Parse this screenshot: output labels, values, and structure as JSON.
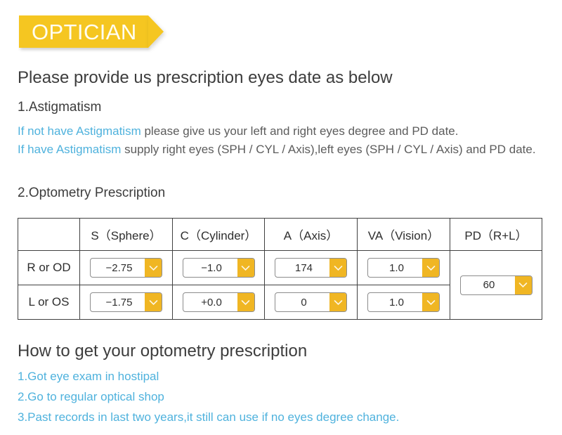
{
  "banner": {
    "label": "OPTICIAN",
    "color": "#f5c621",
    "text_color": "#fffdf2"
  },
  "headings": {
    "main": "Please provide us prescription eyes date as below",
    "section1": "1.Astigmatism",
    "section2": "2.Optometry Prescription",
    "how_to": "How to get your optometry prescription"
  },
  "astigmatism": {
    "line1_highlight": "If not have Astigmatism",
    "line1_rest": "  please give us your left and right eyes degree and PD date.",
    "line2_highlight": "If have Astigmatism",
    "line2_rest": "  supply right eyes (SPH / CYL / Axis),left eyes (SPH / CYL / Axis) and PD date.",
    "highlight_color": "#4fb2dd"
  },
  "table": {
    "columns": [
      "",
      "S（Sphere）",
      "C（Cylinder）",
      "A（Axis）",
      "VA（Vision）",
      "PD（R+L）"
    ],
    "rows": [
      {
        "label": "R or OD",
        "sphere": "−2.75",
        "cylinder": "−1.0",
        "axis": "174",
        "va": "1.0"
      },
      {
        "label": "L or OS",
        "sphere": "−1.75",
        "cylinder": "+0.0",
        "axis": "0",
        "va": "1.0"
      }
    ],
    "pd_value": "60",
    "dropdown_button_color": "#f0b623"
  },
  "how_to_list": [
    "1.Got eye exam in hostipal",
    "2.Go to regular optical shop",
    "3.Past records in last two years,it still can use if no eyes degree change."
  ]
}
